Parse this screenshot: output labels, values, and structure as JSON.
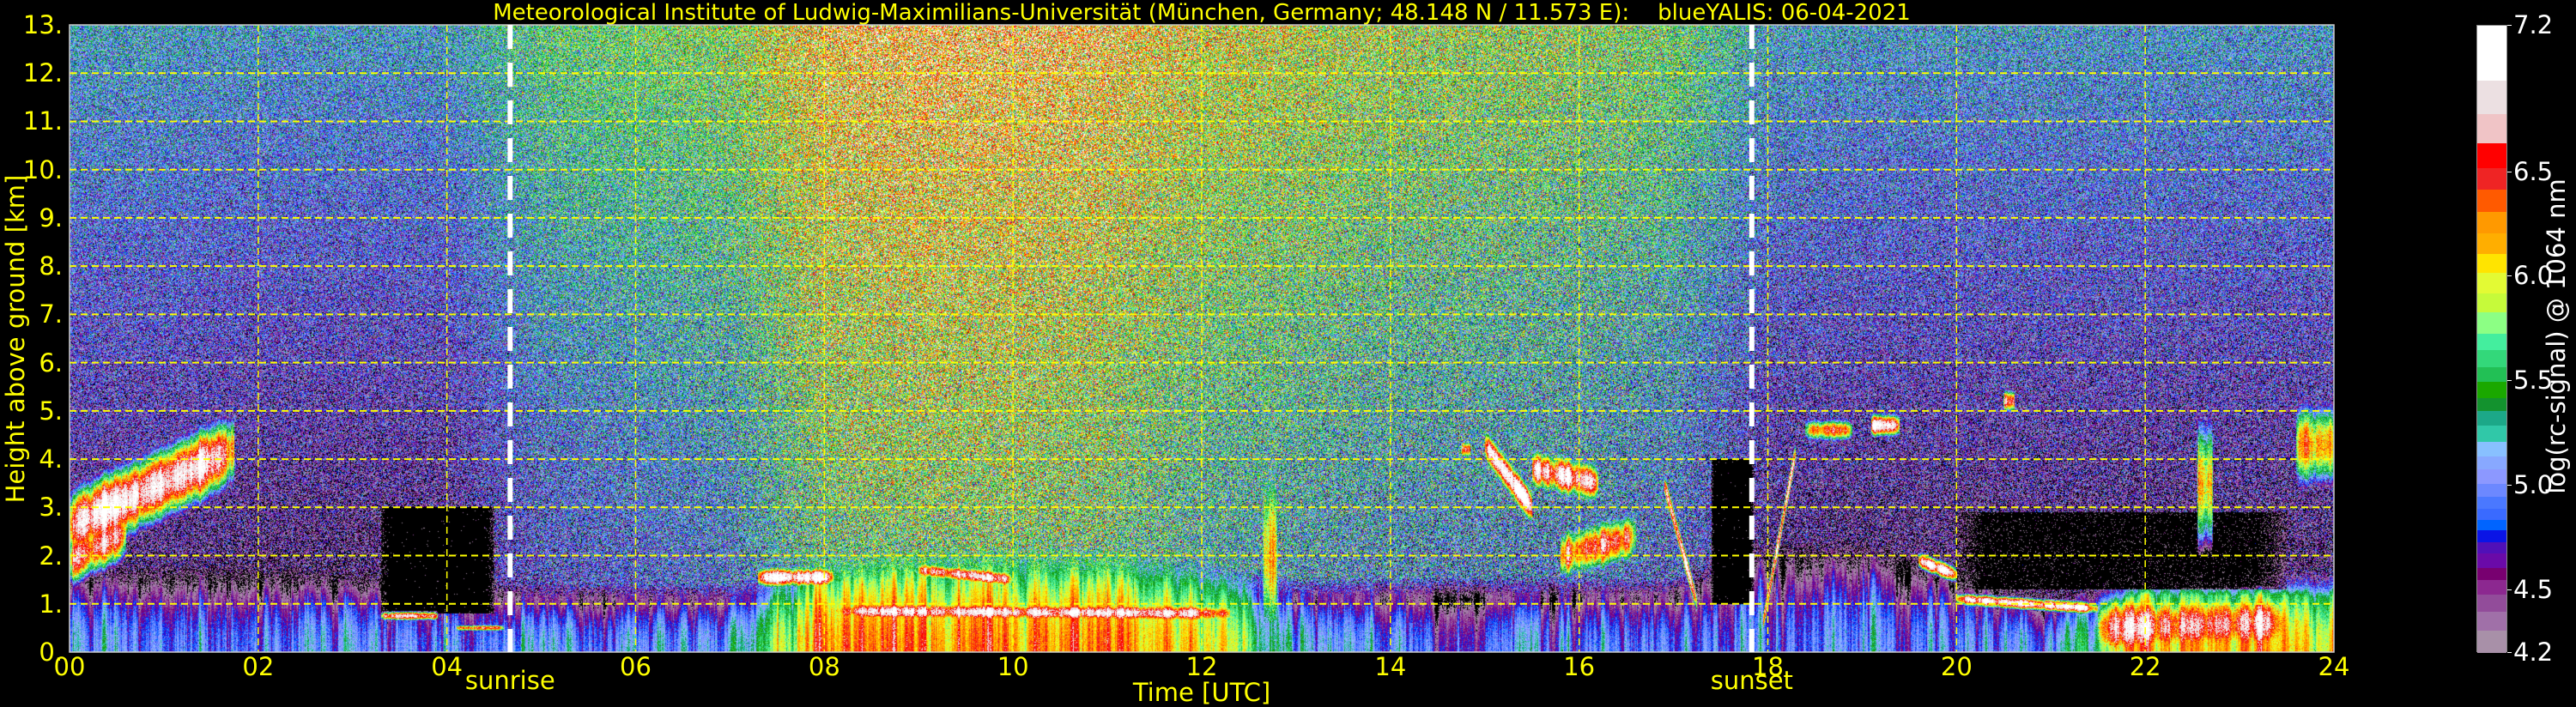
{
  "chart_data": {
    "type": "heatmap",
    "title": "Meteorological Institute of Ludwig-Maximilians-Universität (München, Germany; 48.148 N / 11.573 E):    blueYALIS: 06-04-2021",
    "xlabel": "Time [UTC]",
    "ylabel": "Height above ground [km]",
    "xlim": [
      0,
      24
    ],
    "ylim": [
      0,
      13
    ],
    "xticks": [
      0,
      2,
      4,
      6,
      8,
      10,
      12,
      14,
      16,
      18,
      20,
      22,
      24
    ],
    "xtick_labels": [
      "00",
      "02",
      "04",
      "06",
      "08",
      "10",
      "12",
      "14",
      "16",
      "18",
      "20",
      "22",
      "24"
    ],
    "yticks": [
      0,
      1,
      2,
      3,
      4,
      5,
      6,
      7,
      8,
      9,
      10,
      11,
      12,
      13
    ],
    "ytick_labels": [
      "0.",
      "1.",
      "2.",
      "3.",
      "4.",
      "5.",
      "6.",
      "7.",
      "8.",
      "9.",
      "10.",
      "11.",
      "12.",
      "13."
    ],
    "grid": true,
    "grid_color": "#ffff00",
    "annotations": [
      {
        "label": "sunrise",
        "time": 4.67
      },
      {
        "label": "sunset",
        "time": 17.83
      }
    ],
    "colorbar": {
      "label": "log(rc-signal) @ 1064 nm",
      "min": 4.2,
      "max": 7.2,
      "ticks": [
        4.2,
        4.5,
        5.0,
        5.5,
        6.0,
        6.5,
        7.2
      ],
      "tick_labels": [
        "4.2",
        "4.5",
        "5.0",
        "5.5",
        "6.0",
        "6.5",
        "7.2"
      ],
      "boundaries": [
        4.2,
        4.31,
        4.4,
        4.48,
        4.55,
        4.61,
        4.68,
        4.73,
        4.79,
        4.84,
        4.89,
        4.95,
        5.01,
        5.08,
        5.14,
        5.21,
        5.29,
        5.36,
        5.42,
        5.5,
        5.57,
        5.65,
        5.73,
        5.83,
        5.92,
        6.02,
        6.11,
        6.21,
        6.31,
        6.42,
        6.52,
        6.64,
        6.78,
        6.94,
        7.2
      ],
      "colors": [
        "#a890a8",
        "#a070a8",
        "#924c9a",
        "#8c2890",
        "#780070",
        "#6a0aa8",
        "#5010b8",
        "#0a14e6",
        "#0064ff",
        "#3a6aff",
        "#4a78ff",
        "#6c88ff",
        "#8c98ff",
        "#88a8ff",
        "#88c0ff",
        "#30c8a8",
        "#1ca888",
        "#13922e",
        "#1aa800",
        "#22c055",
        "#33d87a",
        "#44ee9e",
        "#8cff84",
        "#c6fa3a",
        "#e3fa34",
        "#ffe400",
        "#ffae00",
        "#ff9900",
        "#ff5a00",
        "#ef2424",
        "#ff0000",
        "#f0c4c6",
        "#ece0e2",
        "#ffffff"
      ],
      "below_min_color": "#000000"
    },
    "field_hours": [
      0,
      1,
      2,
      3,
      4,
      5,
      6,
      7,
      8,
      9,
      10,
      11,
      12,
      13,
      14,
      15,
      16,
      17,
      18,
      19,
      20,
      21,
      22,
      23,
      24
    ],
    "free_troposphere_mean": [
      4.75,
      4.75,
      4.7,
      4.7,
      4.72,
      5.1,
      5.2,
      5.3,
      5.85,
      5.95,
      5.95,
      5.85,
      5.6,
      5.5,
      5.4,
      5.35,
      5.3,
      5.2,
      4.75,
      4.7,
      4.7,
      4.7,
      4.7,
      4.7,
      4.7
    ],
    "free_troposphere_noise": [
      0.35,
      0.35,
      0.35,
      0.35,
      0.35,
      0.4,
      0.4,
      0.45,
      0.55,
      0.55,
      0.55,
      0.55,
      0.5,
      0.5,
      0.5,
      0.5,
      0.5,
      0.45,
      0.38,
      0.36,
      0.36,
      0.36,
      0.36,
      0.36,
      0.36
    ],
    "boundary_layer_top_km": [
      1.4,
      1.4,
      1.4,
      1.3,
      1.2,
      1.1,
      1.1,
      1.1,
      1.6,
      1.7,
      1.7,
      1.7,
      1.5,
      1.2,
      1.2,
      1.2,
      1.2,
      1.2,
      1.8,
      1.8,
      1.4,
      0.9,
      1.3,
      1.3,
      1.3
    ],
    "boundary_layer_surface_value": [
      5.0,
      5.0,
      5.0,
      5.0,
      5.0,
      5.0,
      5.0,
      5.0,
      6.3,
      6.3,
      6.3,
      6.3,
      6.1,
      5.2,
      5.0,
      4.9,
      4.9,
      4.9,
      4.9,
      4.9,
      5.0,
      5.0,
      6.2,
      6.2,
      6.0
    ],
    "features": [
      {
        "t": [
          0.0,
          1.75
        ],
        "h": [
          2.6,
          4.2
        ],
        "thick": 1.3,
        "value": 7.0,
        "mode": "cloud"
      },
      {
        "t": [
          0.0,
          0.6
        ],
        "h": [
          1.9,
          2.5
        ],
        "thick": 1.0,
        "value": 6.6,
        "mode": "cloud"
      },
      {
        "t": [
          3.3,
          4.5
        ],
        "h": [
          1.9,
          1.9
        ],
        "thick": 2.2,
        "value": 3.5,
        "mode": "clear"
      },
      {
        "t": [
          3.3,
          3.9
        ],
        "h": [
          0.75,
          0.75
        ],
        "thick": 0.16,
        "value": 6.9,
        "mode": "cloud"
      },
      {
        "t": [
          4.1,
          4.6
        ],
        "h": [
          0.5,
          0.5
        ],
        "thick": 0.12,
        "value": 6.6,
        "mode": "cloud"
      },
      {
        "t": [
          7.3,
          8.1
        ],
        "h": [
          1.55,
          1.55
        ],
        "thick": 0.35,
        "value": 7.0,
        "mode": "cloud"
      },
      {
        "t": [
          8.1,
          12.3
        ],
        "h": [
          0.85,
          0.8
        ],
        "thick": 0.35,
        "value": 6.9,
        "mode": "cloud"
      },
      {
        "t": [
          9.0,
          10.0
        ],
        "h": [
          1.7,
          1.5
        ],
        "thick": 0.3,
        "value": 6.8,
        "mode": "cloud"
      },
      {
        "t": [
          12.65,
          12.8
        ],
        "h": [
          2.0,
          2.0
        ],
        "thick": 3.6,
        "value": 6.3,
        "mode": "cloud"
      },
      {
        "t": [
          14.75,
          14.85
        ],
        "h": [
          4.2,
          4.2
        ],
        "thick": 0.3,
        "value": 6.8,
        "mode": "cloud"
      },
      {
        "t": [
          15.0,
          15.5
        ],
        "h": [
          4.3,
          3.0
        ],
        "thick": 0.6,
        "value": 7.0,
        "mode": "cloud"
      },
      {
        "t": [
          15.5,
          16.2
        ],
        "h": [
          3.8,
          3.5
        ],
        "thick": 0.7,
        "value": 6.9,
        "mode": "cloud"
      },
      {
        "t": [
          15.8,
          16.6
        ],
        "h": [
          2.0,
          2.4
        ],
        "thick": 0.9,
        "value": 6.5,
        "mode": "cloud"
      },
      {
        "t": [
          17.4,
          17.85
        ],
        "h": [
          2.5,
          2.5
        ],
        "thick": 3.0,
        "value": 3.5,
        "mode": "clear"
      },
      {
        "t": [
          16.9,
          17.25
        ],
        "h": [
          3.5,
          1.0
        ],
        "thick": 0.4,
        "value": 6.9,
        "mode": "cloud"
      },
      {
        "t": [
          17.95,
          18.3
        ],
        "h": [
          0.6,
          4.2
        ],
        "thick": 0.4,
        "value": 6.9,
        "mode": "cloud"
      },
      {
        "t": [
          18.4,
          18.9
        ],
        "h": [
          4.6,
          4.6
        ],
        "thick": 0.4,
        "value": 6.3,
        "mode": "cloud"
      },
      {
        "t": [
          19.1,
          19.4
        ],
        "h": [
          4.7,
          4.7
        ],
        "thick": 0.4,
        "value": 6.9,
        "mode": "cloud"
      },
      {
        "t": [
          20.0,
          23.5
        ],
        "h": [
          2.1,
          2.1
        ],
        "thick": 1.6,
        "value": 3.8,
        "mode": "clear"
      },
      {
        "t": [
          19.6,
          20.0
        ],
        "h": [
          1.9,
          1.6
        ],
        "thick": 0.3,
        "value": 7.0,
        "mode": "cloud"
      },
      {
        "t": [
          20.0,
          21.5
        ],
        "h": [
          1.1,
          0.9
        ],
        "thick": 0.22,
        "value": 7.0,
        "mode": "cloud"
      },
      {
        "t": [
          20.5,
          20.62
        ],
        "h": [
          5.2,
          5.2
        ],
        "thick": 0.4,
        "value": 6.6,
        "mode": "cloud"
      },
      {
        "t": [
          22.55,
          22.72
        ],
        "h": [
          3.5,
          3.5
        ],
        "thick": 2.6,
        "value": 6.2,
        "mode": "cloud"
      },
      {
        "t": [
          21.5,
          23.5
        ],
        "h": [
          0.5,
          0.6
        ],
        "thick": 1.2,
        "value": 6.7,
        "mode": "cloud"
      },
      {
        "t": [
          23.6,
          24.0
        ],
        "h": [
          4.3,
          4.3
        ],
        "thick": 1.6,
        "value": 6.3,
        "mode": "cloud"
      }
    ]
  }
}
